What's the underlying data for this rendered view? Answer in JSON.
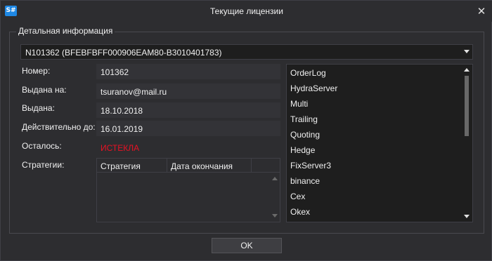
{
  "window": {
    "title": "Текущие лицензии",
    "app_icon_text": "S#",
    "close_glyph": "✕"
  },
  "group": {
    "legend": "Детальная информация"
  },
  "license_combo": {
    "selected": "N101362 (BFEBFBFF000906EAM80-B3010401783)"
  },
  "fields": {
    "number_label": "Номер:",
    "number_value": "101362",
    "issued_to_label": "Выдана на:",
    "issued_to_value": "tsuranov@mail.ru",
    "issued_label": "Выдана:",
    "issued_value": "18.10.2018",
    "valid_until_label": "Действительно до:",
    "valid_until_value": "16.01.2019",
    "remaining_label": "Осталось:",
    "remaining_value": "ИСТЕКЛА",
    "strategies_label": "Стратегии:"
  },
  "strategies_grid": {
    "columns": [
      "Стратегия",
      "Дата окончания"
    ],
    "rows": []
  },
  "features": [
    "OrderLog",
    "HydraServer",
    "Multi",
    "Trailing",
    "Quoting",
    "Hedge",
    "FixServer3",
    "binance",
    "Cex",
    "Okex"
  ],
  "ok_label": "OK",
  "colors": {
    "background": "#2d2d30",
    "input": "#1e1e1e",
    "expired": "#e81123",
    "accent": "#1e88e5"
  }
}
